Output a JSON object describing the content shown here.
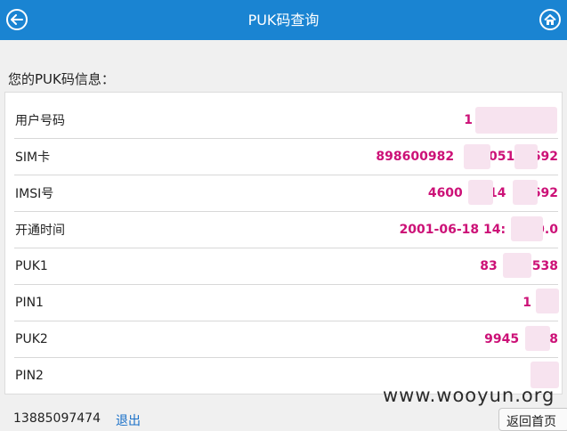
{
  "header": {
    "title": "PUK码查询",
    "back_icon": "arrow-left-icon",
    "home_icon": "home-icon"
  },
  "section_label": "您的PUK码信息：",
  "rows": [
    {
      "label": "用户号码",
      "value": "1"
    },
    {
      "label": "SIM卡",
      "value": "898600982        051    692"
    },
    {
      "label": "IMSI号",
      "value": "4600      14      692"
    },
    {
      "label": "开通时间",
      "value": "2001-06-18 14:       0.0"
    },
    {
      "label": "PUK1",
      "value": "83        538"
    },
    {
      "label": "PIN1",
      "value": "1"
    },
    {
      "label": "PUK2",
      "value": "9945       8"
    },
    {
      "label": "PIN2",
      "value": ""
    }
  ],
  "footer": {
    "phone": "13885097474",
    "logout": "退出",
    "return_home": "返回首页"
  },
  "watermark": "www.wooyun.org",
  "colors": {
    "header_bg": "#1a84d2",
    "value_text": "#cc1177",
    "link": "#1a70c8"
  }
}
